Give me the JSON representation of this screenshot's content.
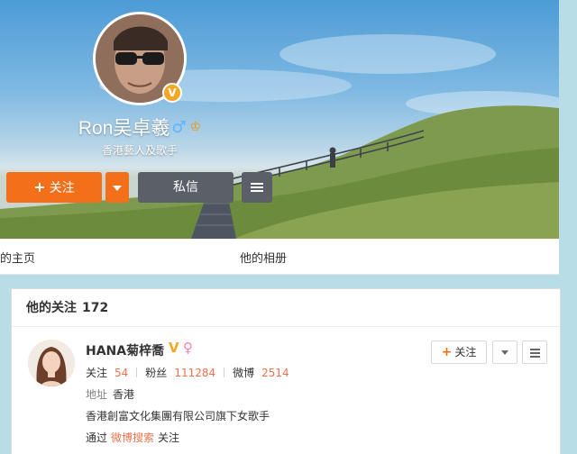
{
  "profile": {
    "name": "Ron吴卓羲",
    "bio": "香港藝人及歌手",
    "verified_icon": "v-badge-icon",
    "gender_icon": "male-icon",
    "follow_label": "关注",
    "message_label": "私信"
  },
  "tabs": [
    {
      "label": "的主页"
    },
    {
      "label": "他的相册"
    }
  ],
  "following": {
    "title": "他的关注",
    "count": "172",
    "user": {
      "name": "HANA菊梓喬",
      "stats": {
        "follow_label": "关注",
        "follow_value": "54",
        "fans_label": "粉丝",
        "fans_value": "111284",
        "weibo_label": "微博",
        "weibo_value": "2514"
      },
      "address_label": "地址",
      "address_value": "香港",
      "description": "香港創富文化集團有限公司旗下女歌手",
      "via_prefix": "通过",
      "via_link": "微博搜索",
      "via_suffix": "关注",
      "follow_button": "关注"
    }
  },
  "colors": {
    "accent": "#f46f1a",
    "link": "#eb7350",
    "dark_button": "#5a5f68",
    "background": "#b9dde6"
  }
}
